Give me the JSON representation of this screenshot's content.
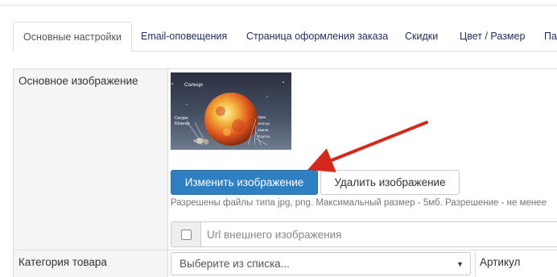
{
  "tabs": [
    {
      "label": "Основные настройки",
      "active": true
    },
    {
      "label": "Email-оповещения",
      "active": false
    },
    {
      "label": "Страница оформления заказа",
      "active": false
    },
    {
      "label": "Скидки",
      "active": false
    },
    {
      "label": "Цвет / Размер",
      "active": false
    },
    {
      "label": "Па",
      "active": false
    }
  ],
  "form": {
    "main_image_label": "Основное изображение",
    "category_label": "Категория товара",
    "article_label": "Артикул"
  },
  "preview": {
    "sun_label": "Солнце",
    "left_labels": [
      "Сатурн",
      "Юпитер"
    ],
    "right_labels": [
      "Уран",
      "Нептун",
      "Земля",
      "Плутон"
    ]
  },
  "buttons": {
    "change_image": "Изменить изображение",
    "delete_image": "Удалить изображение"
  },
  "hint": "Разрешены файлы типа jpg, png. Максимальный размер - 5мб. Разрешение - не менее",
  "url_field": {
    "placeholder": "Url внешнего изображения",
    "checked": false
  },
  "category_select": {
    "selected": "Выберите из списка..."
  },
  "colors": {
    "primary": "#2f7fc3",
    "tab_link": "#1f2d5c",
    "annotation_arrow": "#d42a1c"
  }
}
